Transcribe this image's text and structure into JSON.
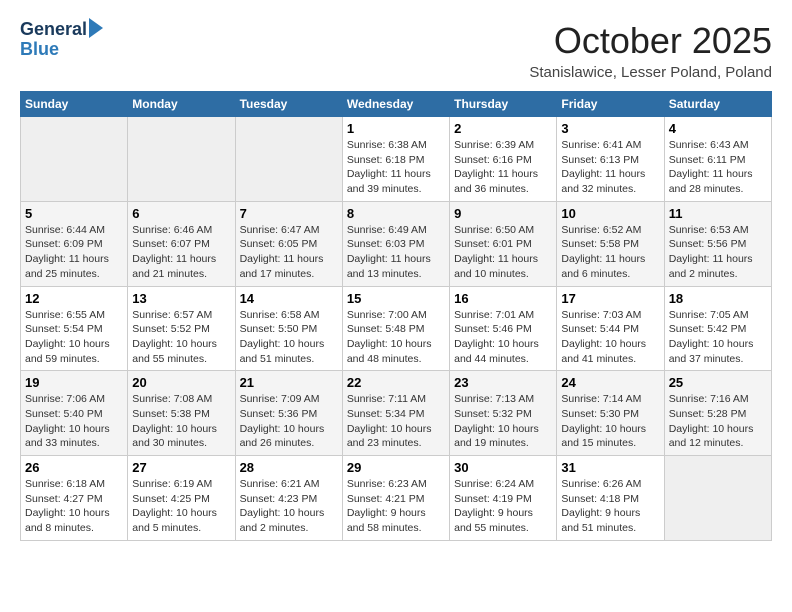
{
  "header": {
    "logo_line1": "General",
    "logo_line2": "Blue",
    "month": "October 2025",
    "location": "Stanislawice, Lesser Poland, Poland"
  },
  "days_of_week": [
    "Sunday",
    "Monday",
    "Tuesday",
    "Wednesday",
    "Thursday",
    "Friday",
    "Saturday"
  ],
  "weeks": [
    [
      {
        "num": "",
        "info": ""
      },
      {
        "num": "",
        "info": ""
      },
      {
        "num": "",
        "info": ""
      },
      {
        "num": "1",
        "info": "Sunrise: 6:38 AM\nSunset: 6:18 PM\nDaylight: 11 hours and 39 minutes."
      },
      {
        "num": "2",
        "info": "Sunrise: 6:39 AM\nSunset: 6:16 PM\nDaylight: 11 hours and 36 minutes."
      },
      {
        "num": "3",
        "info": "Sunrise: 6:41 AM\nSunset: 6:13 PM\nDaylight: 11 hours and 32 minutes."
      },
      {
        "num": "4",
        "info": "Sunrise: 6:43 AM\nSunset: 6:11 PM\nDaylight: 11 hours and 28 minutes."
      }
    ],
    [
      {
        "num": "5",
        "info": "Sunrise: 6:44 AM\nSunset: 6:09 PM\nDaylight: 11 hours and 25 minutes."
      },
      {
        "num": "6",
        "info": "Sunrise: 6:46 AM\nSunset: 6:07 PM\nDaylight: 11 hours and 21 minutes."
      },
      {
        "num": "7",
        "info": "Sunrise: 6:47 AM\nSunset: 6:05 PM\nDaylight: 11 hours and 17 minutes."
      },
      {
        "num": "8",
        "info": "Sunrise: 6:49 AM\nSunset: 6:03 PM\nDaylight: 11 hours and 13 minutes."
      },
      {
        "num": "9",
        "info": "Sunrise: 6:50 AM\nSunset: 6:01 PM\nDaylight: 11 hours and 10 minutes."
      },
      {
        "num": "10",
        "info": "Sunrise: 6:52 AM\nSunset: 5:58 PM\nDaylight: 11 hours and 6 minutes."
      },
      {
        "num": "11",
        "info": "Sunrise: 6:53 AM\nSunset: 5:56 PM\nDaylight: 11 hours and 2 minutes."
      }
    ],
    [
      {
        "num": "12",
        "info": "Sunrise: 6:55 AM\nSunset: 5:54 PM\nDaylight: 10 hours and 59 minutes."
      },
      {
        "num": "13",
        "info": "Sunrise: 6:57 AM\nSunset: 5:52 PM\nDaylight: 10 hours and 55 minutes."
      },
      {
        "num": "14",
        "info": "Sunrise: 6:58 AM\nSunset: 5:50 PM\nDaylight: 10 hours and 51 minutes."
      },
      {
        "num": "15",
        "info": "Sunrise: 7:00 AM\nSunset: 5:48 PM\nDaylight: 10 hours and 48 minutes."
      },
      {
        "num": "16",
        "info": "Sunrise: 7:01 AM\nSunset: 5:46 PM\nDaylight: 10 hours and 44 minutes."
      },
      {
        "num": "17",
        "info": "Sunrise: 7:03 AM\nSunset: 5:44 PM\nDaylight: 10 hours and 41 minutes."
      },
      {
        "num": "18",
        "info": "Sunrise: 7:05 AM\nSunset: 5:42 PM\nDaylight: 10 hours and 37 minutes."
      }
    ],
    [
      {
        "num": "19",
        "info": "Sunrise: 7:06 AM\nSunset: 5:40 PM\nDaylight: 10 hours and 33 minutes."
      },
      {
        "num": "20",
        "info": "Sunrise: 7:08 AM\nSunset: 5:38 PM\nDaylight: 10 hours and 30 minutes."
      },
      {
        "num": "21",
        "info": "Sunrise: 7:09 AM\nSunset: 5:36 PM\nDaylight: 10 hours and 26 minutes."
      },
      {
        "num": "22",
        "info": "Sunrise: 7:11 AM\nSunset: 5:34 PM\nDaylight: 10 hours and 23 minutes."
      },
      {
        "num": "23",
        "info": "Sunrise: 7:13 AM\nSunset: 5:32 PM\nDaylight: 10 hours and 19 minutes."
      },
      {
        "num": "24",
        "info": "Sunrise: 7:14 AM\nSunset: 5:30 PM\nDaylight: 10 hours and 15 minutes."
      },
      {
        "num": "25",
        "info": "Sunrise: 7:16 AM\nSunset: 5:28 PM\nDaylight: 10 hours and 12 minutes."
      }
    ],
    [
      {
        "num": "26",
        "info": "Sunrise: 6:18 AM\nSunset: 4:27 PM\nDaylight: 10 hours and 8 minutes."
      },
      {
        "num": "27",
        "info": "Sunrise: 6:19 AM\nSunset: 4:25 PM\nDaylight: 10 hours and 5 minutes."
      },
      {
        "num": "28",
        "info": "Sunrise: 6:21 AM\nSunset: 4:23 PM\nDaylight: 10 hours and 2 minutes."
      },
      {
        "num": "29",
        "info": "Sunrise: 6:23 AM\nSunset: 4:21 PM\nDaylight: 9 hours and 58 minutes."
      },
      {
        "num": "30",
        "info": "Sunrise: 6:24 AM\nSunset: 4:19 PM\nDaylight: 9 hours and 55 minutes."
      },
      {
        "num": "31",
        "info": "Sunrise: 6:26 AM\nSunset: 4:18 PM\nDaylight: 9 hours and 51 minutes."
      },
      {
        "num": "",
        "info": ""
      }
    ]
  ]
}
